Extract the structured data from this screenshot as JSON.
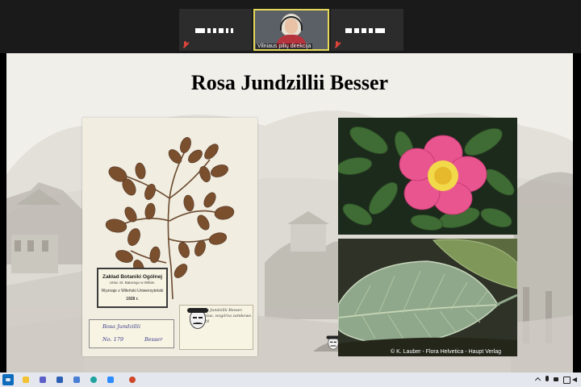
{
  "gallery": {
    "tiles": [
      {
        "id": "participant-left",
        "masked": true
      },
      {
        "id": "active-speaker",
        "name": "Vilniaus pilių direkcija",
        "muted": true
      },
      {
        "id": "participant-right",
        "masked": true
      }
    ],
    "active_border_color": "#e5d95a"
  },
  "slide": {
    "title": "Rosa Jundzillii Besser",
    "herbarium": {
      "label_title": "Zakład Botaniki Ogólnej",
      "label_subtitle": "Uniw. St. Batorego w Wilnie.",
      "label_line2": "Wyznaje z Wileński Uniwersytetski",
      "label_year": "1928 r.",
      "note_name": "Rosa Jundzillii",
      "note_left": "No. 179",
      "note_right": "Besser",
      "handwriting": "Rosa Jundzillii Besser. Vilnius, wzgórza zamkowe. 1928"
    },
    "photo_credit": "© K. Lauber - Flora Helvetica - Haupt Verlag"
  },
  "taskbar": {
    "apps": [
      "start-icon",
      "file-explorer-icon",
      "teams-icon",
      "word-icon",
      "vpn-icon",
      "edge-icon",
      "zoom-icon",
      "photos-icon",
      "powerpoint-icon"
    ],
    "tray": [
      "chevron-up-icon",
      "microphone-icon",
      "camera-icon",
      "network-icon",
      "volume-icon"
    ]
  }
}
